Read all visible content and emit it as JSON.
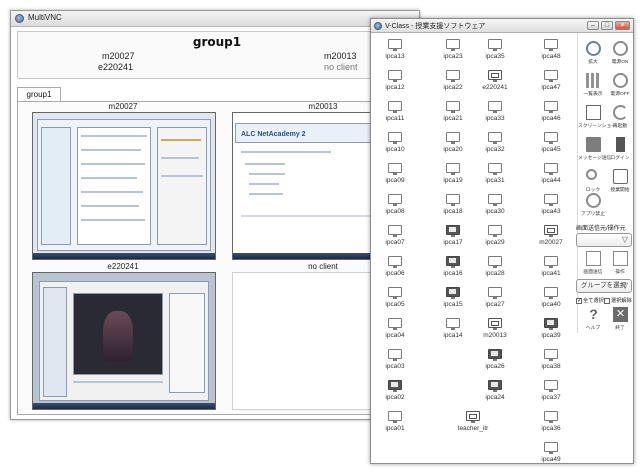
{
  "vnc_window": {
    "title": "MultiVNC",
    "group_title": "group1",
    "header_hosts": [
      {
        "name": "m20027"
      },
      {
        "name": "e220241"
      },
      {
        "name": "m20013"
      },
      {
        "name": "no client"
      }
    ],
    "tab_label": "group1",
    "thumbnails": [
      {
        "caption": "m20027"
      },
      {
        "caption": "m20013"
      },
      {
        "caption": "e220241"
      },
      {
        "caption": "no client"
      }
    ],
    "thumb2_heading": "ALC NetAcademy 2"
  },
  "vclass_window": {
    "title": "V-Class - 授業支援ソフトウェア",
    "window_buttons": [
      "–",
      "□",
      "×"
    ],
    "computers": [
      {
        "label": "ipca13",
        "state": "off"
      },
      {
        "label": "ipca23",
        "state": "off"
      },
      {
        "label": "ipca35",
        "state": "off"
      },
      {
        "label": "ipca48",
        "state": "off"
      },
      {
        "label": "ipca12",
        "state": "off"
      },
      {
        "label": "ipca22",
        "state": "off"
      },
      {
        "label": "e220241",
        "state": "active"
      },
      {
        "label": "ipca47",
        "state": "off"
      },
      {
        "label": "ipca11",
        "state": "off"
      },
      {
        "label": "ipca21",
        "state": "off"
      },
      {
        "label": "ipca33",
        "state": "off"
      },
      {
        "label": "ipca46",
        "state": "off"
      },
      {
        "label": "ipca10",
        "state": "off"
      },
      {
        "label": "ipca20",
        "state": "off"
      },
      {
        "label": "ipca32",
        "state": "off"
      },
      {
        "label": "ipca45",
        "state": "off"
      },
      {
        "label": "ipca09",
        "state": "off"
      },
      {
        "label": "ipca19",
        "state": "off"
      },
      {
        "label": "ipca31",
        "state": "off"
      },
      {
        "label": "ipca44",
        "state": "off"
      },
      {
        "label": "ipca08",
        "state": "off"
      },
      {
        "label": "ipca18",
        "state": "off"
      },
      {
        "label": "ipca30",
        "state": "off"
      },
      {
        "label": "ipca43",
        "state": "off"
      },
      {
        "label": "ipca07",
        "state": "off"
      },
      {
        "label": "ipca17",
        "state": "on"
      },
      {
        "label": "ipca29",
        "state": "off"
      },
      {
        "label": "m20027",
        "state": "active"
      },
      {
        "label": "ipca06",
        "state": "off"
      },
      {
        "label": "ipca16",
        "state": "on"
      },
      {
        "label": "ipca28",
        "state": "off"
      },
      {
        "label": "ipca41",
        "state": "off"
      },
      {
        "label": "ipca05",
        "state": "off"
      },
      {
        "label": "ipca15",
        "state": "on"
      },
      {
        "label": "ipca27",
        "state": "off"
      },
      {
        "label": "ipca40",
        "state": "off"
      },
      {
        "label": "ipca04",
        "state": "off"
      },
      {
        "label": "ipca14",
        "state": "off"
      },
      {
        "label": "m20013",
        "state": "active"
      },
      {
        "label": "ipca39",
        "state": "on"
      },
      {
        "label": "ipca03",
        "state": "off"
      },
      {
        "label": "ipca26",
        "state": "on"
      },
      {
        "label": "ipca38",
        "state": "off"
      },
      {
        "label": "ipca02",
        "state": "on"
      },
      {
        "label": "ipca24",
        "state": "on"
      },
      {
        "label": "ipca37",
        "state": "off"
      },
      {
        "label": "ipca01",
        "state": "off"
      },
      {
        "label": "teacher_itr",
        "state": "active"
      },
      {
        "label": "ipca36",
        "state": "off"
      },
      {
        "label": "ipca49",
        "state": "off"
      }
    ],
    "tools": [
      {
        "label": "拡大",
        "icon": "zoom-icon"
      },
      {
        "label": "電源ON",
        "icon": "power-on-icon"
      },
      {
        "label": "一覧表示",
        "icon": "grid-view-icon"
      },
      {
        "label": "電源OFF",
        "icon": "power-off-icon"
      },
      {
        "label": "スクリーンショー",
        "icon": "screen-show-icon"
      },
      {
        "label": "再起動",
        "icon": "restart-icon"
      },
      {
        "label": "メッセージ送信",
        "icon": "message-icon"
      },
      {
        "label": "ログイン",
        "icon": "login-icon"
      },
      {
        "label": "ロック",
        "icon": "lock-icon"
      },
      {
        "label": "授業開始",
        "icon": "class-start-icon"
      },
      {
        "label": "アプリ禁止",
        "icon": "app-block-icon"
      }
    ],
    "send_section_title": "画面送信元/操作元",
    "remote_tools": [
      {
        "label": "画面送信",
        "icon": "screen-send-icon"
      },
      {
        "label": "操作",
        "icon": "remote-control-icon"
      }
    ],
    "group_select_label": "グループを選択",
    "checkbox_all": "全て選択",
    "checkbox_clear": "選択解除",
    "help_label": "ヘルプ",
    "exit_label": "終了"
  }
}
